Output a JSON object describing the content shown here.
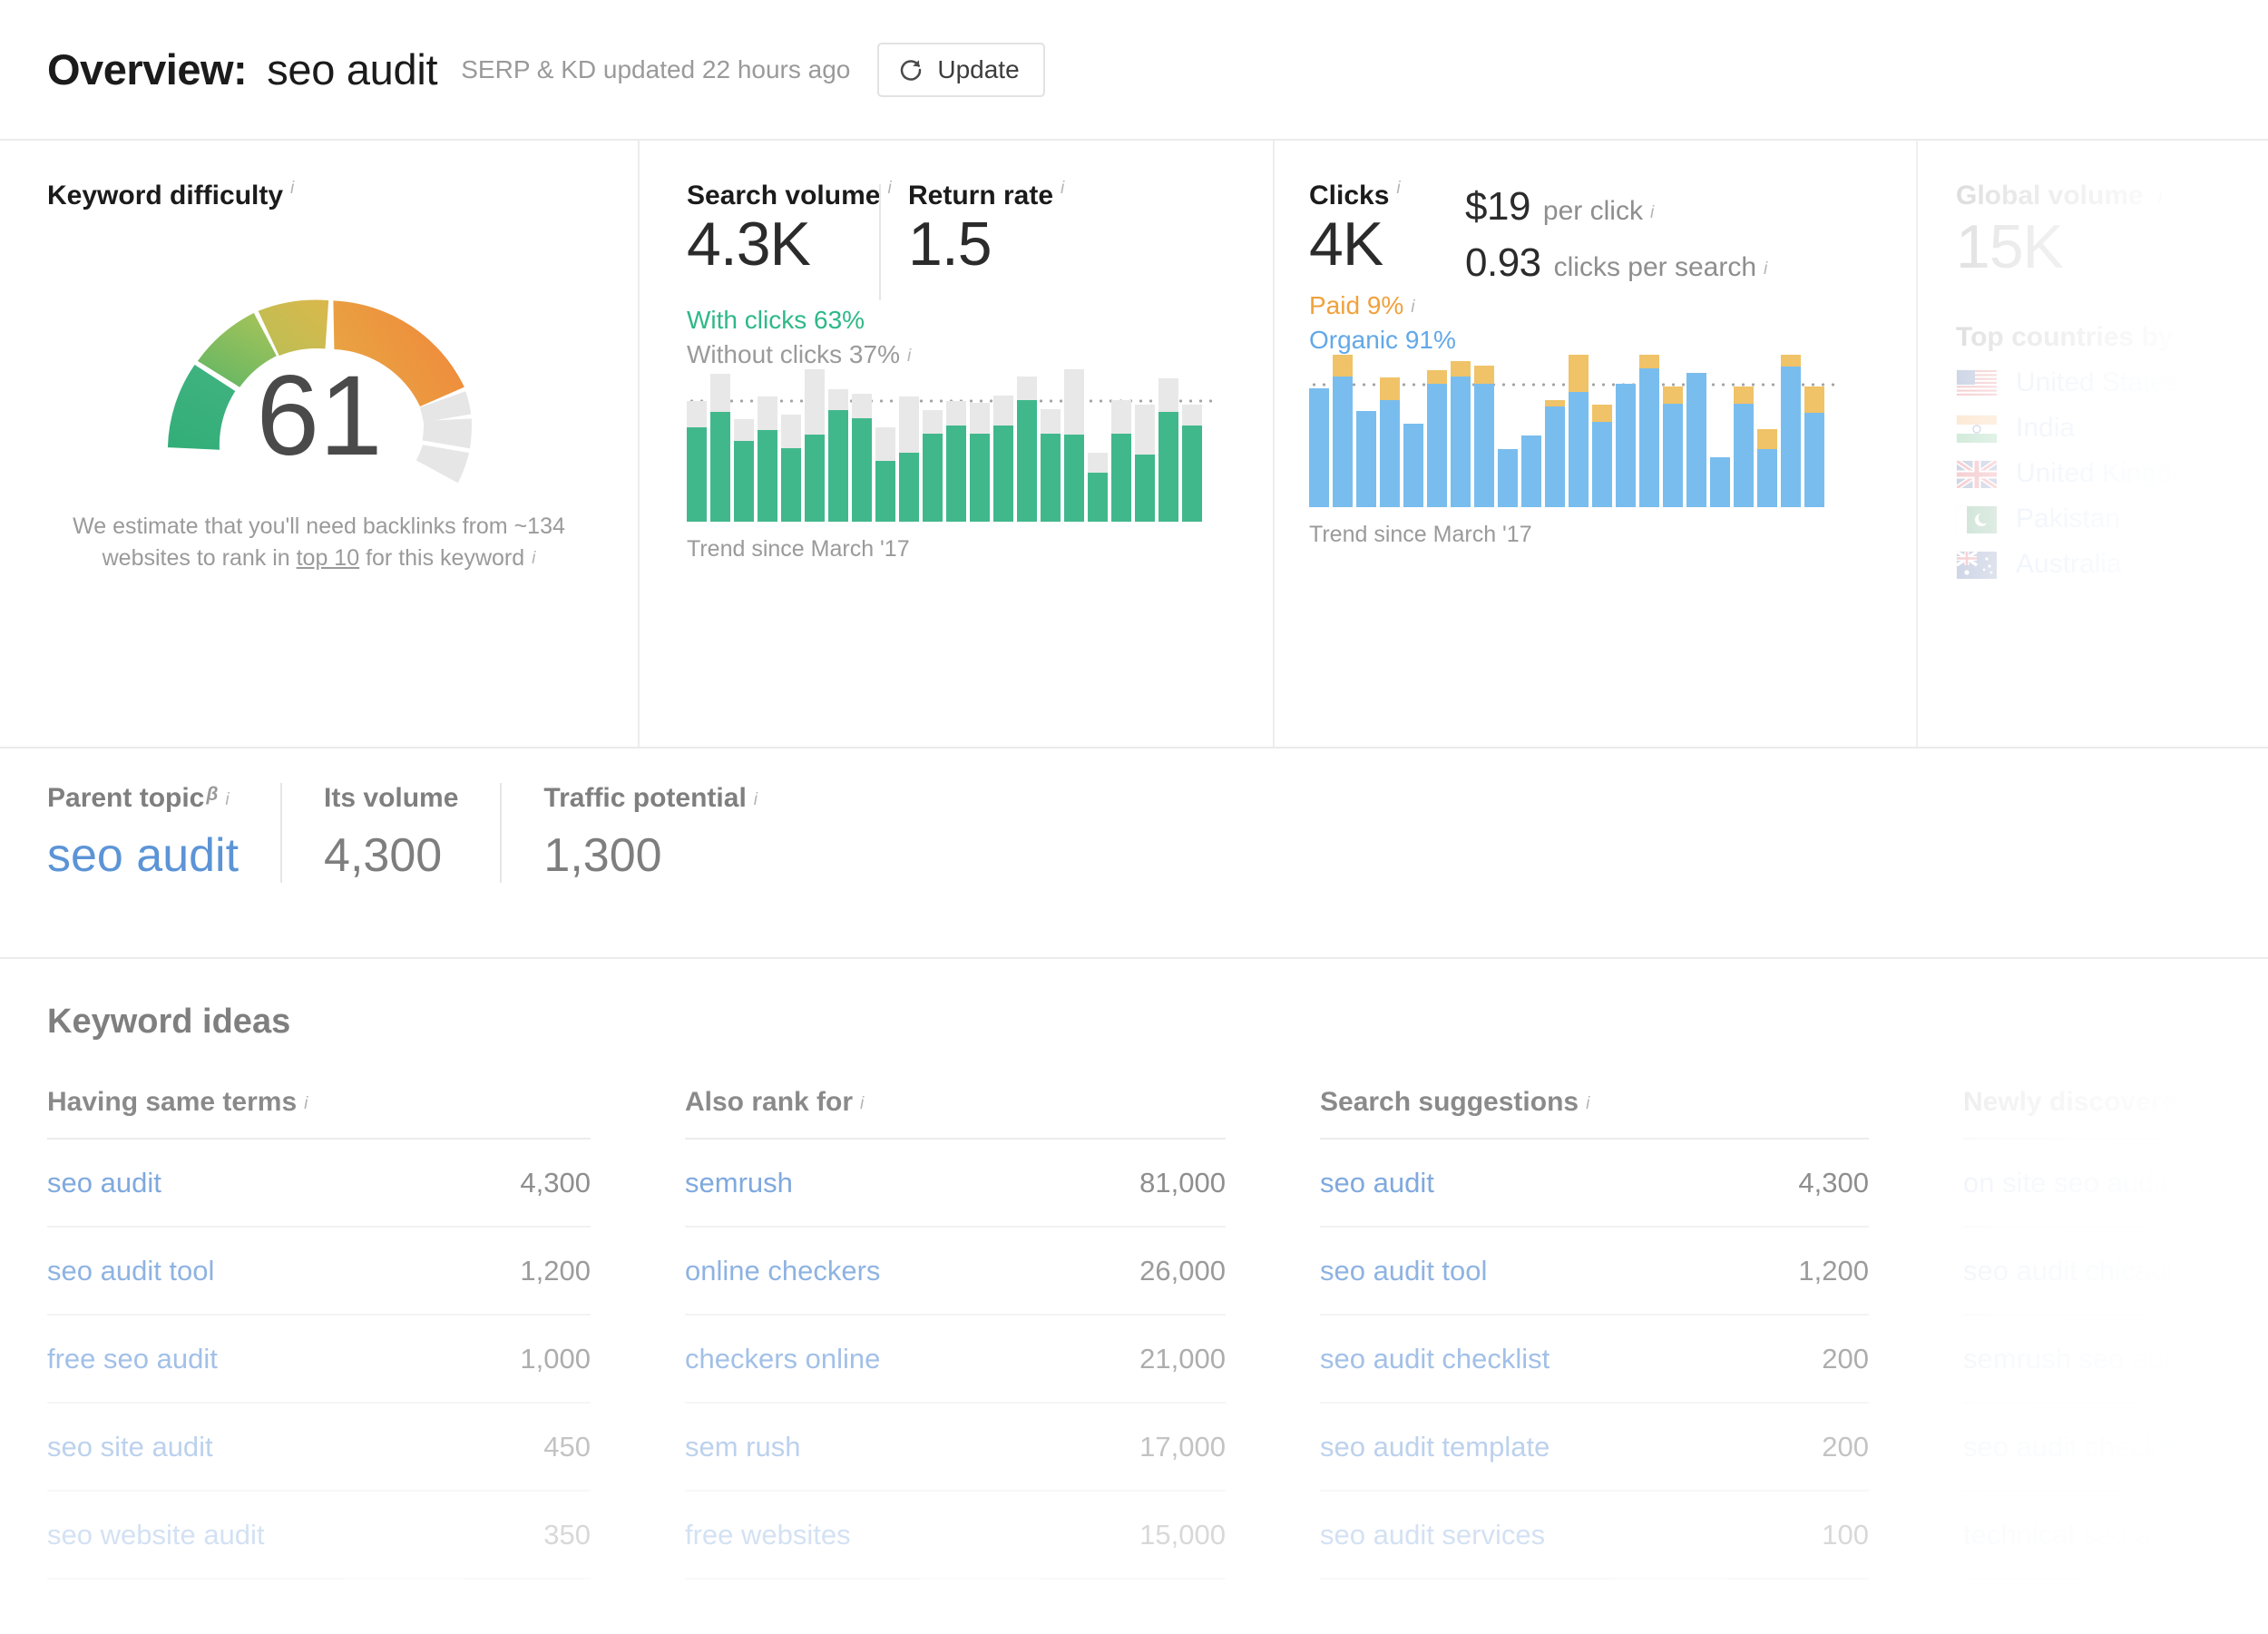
{
  "header": {
    "overview_label": "Overview:",
    "keyword": "seo audit",
    "updated_text": "SERP & KD updated 22 hours ago",
    "update_button": "Update"
  },
  "keyword_difficulty": {
    "title": "Keyword difficulty",
    "info": "i",
    "score": "61",
    "note_part1": "We estimate that you'll need backlinks from ~134 websites to rank in ",
    "note_link": "top 10",
    "note_part2": " for this keyword",
    "note_info": "i"
  },
  "search_volume": {
    "title": "Search volume",
    "info": "i",
    "value": "4.3K",
    "with_clicks": "With clicks 63%",
    "without_clicks": "Without clicks 37%",
    "without_clicks_info": "i",
    "trend_label": "Trend since March '17"
  },
  "return_rate": {
    "title": "Return rate",
    "info": "i",
    "value": "1.5"
  },
  "clicks": {
    "title": "Clicks",
    "info": "i",
    "value": "4K",
    "cpc_value": "$19",
    "cpc_label": "per click",
    "cpc_info": "i",
    "cps_value": "0.93",
    "cps_label": "clicks per search",
    "cps_info": "i",
    "paid": "Paid 9%",
    "paid_info": "i",
    "organic": "Organic 91%",
    "trend_label": "Trend since March '17"
  },
  "global_volume": {
    "title": "Global volume",
    "info": "i",
    "value": "15K",
    "top_countries_title": "Top countries by",
    "countries": [
      {
        "name": "United States",
        "flag": "us-flag-icon"
      },
      {
        "name": "India",
        "flag": "in-flag-icon"
      },
      {
        "name": "United Kingdom",
        "flag": "gb-flag-icon"
      },
      {
        "name": "Pakistan",
        "flag": "pk-flag-icon"
      },
      {
        "name": "Australia",
        "flag": "au-flag-icon"
      }
    ]
  },
  "parent_topic": {
    "label": "Parent topic",
    "beta": "β",
    "info": "i",
    "value": "seo audit",
    "its_volume_label": "Its volume",
    "its_volume_value": "4,300",
    "traffic_potential_label": "Traffic potential",
    "traffic_potential_info": "i",
    "traffic_potential_value": "1,300"
  },
  "keyword_ideas": {
    "title": "Keyword ideas",
    "columns": [
      {
        "header": "Having same terms",
        "info": "i",
        "rows": [
          {
            "keyword": "seo audit",
            "volume": "4,300"
          },
          {
            "keyword": "seo audit tool",
            "volume": "1,200"
          },
          {
            "keyword": "free seo audit",
            "volume": "1,000"
          },
          {
            "keyword": "seo site audit",
            "volume": "450"
          },
          {
            "keyword": "seo website audit",
            "volume": "350"
          }
        ]
      },
      {
        "header": "Also rank for",
        "info": "i",
        "rows": [
          {
            "keyword": "semrush",
            "volume": "81,000"
          },
          {
            "keyword": "online checkers",
            "volume": "26,000"
          },
          {
            "keyword": "checkers online",
            "volume": "21,000"
          },
          {
            "keyword": "sem rush",
            "volume": "17,000"
          },
          {
            "keyword": "free websites",
            "volume": "15,000"
          }
        ]
      },
      {
        "header": "Search suggestions",
        "info": "i",
        "rows": [
          {
            "keyword": "seo audit",
            "volume": "4,300"
          },
          {
            "keyword": "seo audit tool",
            "volume": "1,200"
          },
          {
            "keyword": "seo audit checklist",
            "volume": "200"
          },
          {
            "keyword": "seo audit template",
            "volume": "200"
          },
          {
            "keyword": "seo audit services",
            "volume": "100"
          }
        ]
      },
      {
        "header": "Newly discovered",
        "info": "",
        "rows": [
          {
            "keyword": "on site seo audit",
            "volume": ""
          },
          {
            "keyword": "seo audit chicago",
            "volume": ""
          },
          {
            "keyword": "semrush seo audit",
            "volume": ""
          },
          {
            "keyword": "seo audit checklist",
            "volume": ""
          },
          {
            "keyword": "technical seo audit",
            "volume": ""
          }
        ]
      }
    ]
  },
  "chart_data": [
    {
      "type": "bar",
      "title": "Search volume trend",
      "subtitle": "Trend since March '17",
      "stacked": true,
      "series": [
        {
          "name": "With clicks",
          "color": "#41b88c",
          "values": [
            62,
            72,
            53,
            60,
            48,
            63,
            73,
            68,
            40,
            45,
            58,
            63,
            58,
            63,
            80,
            58,
            70,
            32,
            58,
            44,
            72,
            63
          ]
        },
        {
          "name": "Without clicks",
          "color": "#e8e8e8",
          "values": [
            17,
            25,
            14,
            22,
            22,
            47,
            14,
            16,
            22,
            37,
            15,
            16,
            20,
            20,
            15,
            16,
            52,
            13,
            22,
            33,
            22,
            14
          ]
        }
      ],
      "reference_line": 78,
      "ylim": [
        0,
        130
      ],
      "grid": false,
      "legend": "none"
    },
    {
      "type": "bar",
      "title": "Clicks trend",
      "subtitle": "Trend since March '17",
      "stacked": true,
      "series": [
        {
          "name": "Organic",
          "color": "#79bdee",
          "values": [
            78,
            86,
            63,
            70,
            55,
            81,
            86,
            81,
            38,
            47,
            66,
            81,
            56,
            81,
            105,
            68,
            88,
            33,
            68,
            38,
            99,
            62
          ]
        },
        {
          "name": "Paid",
          "color": "#f0c368",
          "values": [
            0,
            14,
            0,
            15,
            0,
            9,
            10,
            12,
            0,
            0,
            4,
            26,
            11,
            0,
            10,
            11,
            0,
            0,
            11,
            13,
            8,
            17
          ]
        }
      ],
      "reference_line": 79,
      "ylim": [
        0,
        130
      ],
      "grid": false,
      "legend": "none"
    },
    {
      "type": "gauge",
      "title": "Keyword difficulty",
      "value": 61,
      "range": [
        0,
        100
      ],
      "segments": [
        {
          "from": 0,
          "to": 10,
          "color": "#36b07a"
        },
        {
          "from": 11,
          "to": 30,
          "color": "#7fbc5f"
        },
        {
          "from": 31,
          "to": 50,
          "color": "#cfb94e"
        },
        {
          "from": 51,
          "to": 61,
          "color": "#ef8f3c"
        },
        {
          "from": 62,
          "to": 80,
          "color": "#e4e4e4"
        },
        {
          "from": 81,
          "to": 100,
          "color": "#e4e4e4"
        }
      ]
    }
  ],
  "colors": {
    "green": "#41b88c",
    "blue": "#79bdee",
    "orange": "#f0c368",
    "grey_bar": "#e8e8e8",
    "link_blue": "#5c94d6",
    "paid_orange": "#f0a13c",
    "organic_blue": "#62a8e8"
  }
}
